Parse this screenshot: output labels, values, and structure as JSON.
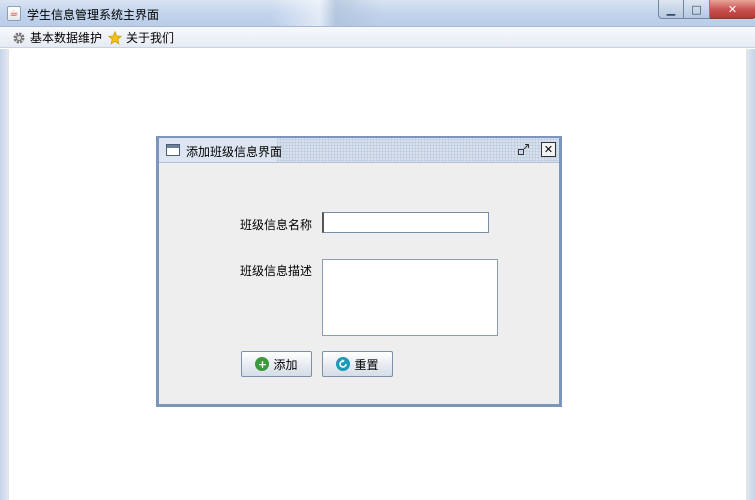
{
  "window": {
    "title": "学生信息管理系统主界面",
    "minimize_glyph": "▁",
    "maximize_glyph": "□",
    "close_glyph": "✕"
  },
  "menubar": {
    "items": [
      {
        "label": "基本数据维护",
        "icon": "gear-icon"
      },
      {
        "label": "关于我们",
        "icon": "star-icon"
      }
    ]
  },
  "internal_frame": {
    "title": "添加班级信息界面",
    "restore_glyph": "⇱",
    "close_glyph": "✕",
    "form": {
      "name_label": "班级信息名称",
      "name_value": "",
      "desc_label": "班级信息描述",
      "desc_value": ""
    },
    "buttons": {
      "add_label": "添加",
      "reset_label": "重置"
    }
  },
  "colors": {
    "frame_border": "#7b95bd",
    "add_icon": "#3a9a3a",
    "reset_icon": "#1d9ab5",
    "star_icon": "#f2c21a"
  }
}
